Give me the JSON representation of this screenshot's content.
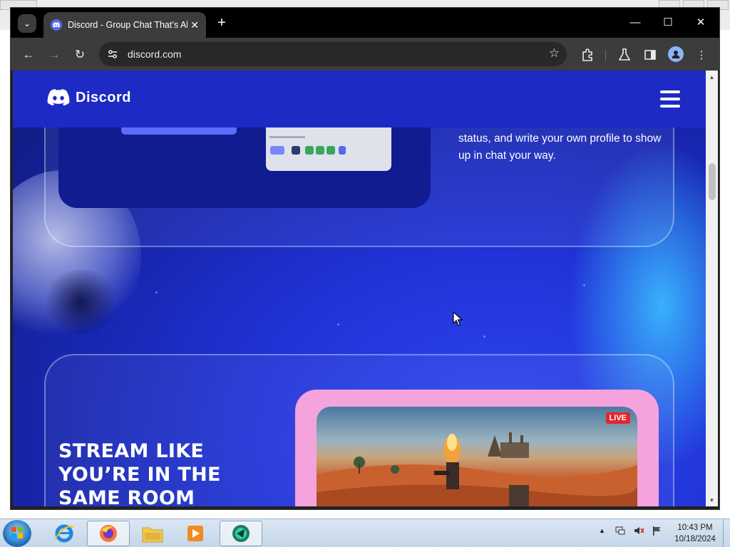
{
  "browser": {
    "tab": {
      "title": "Discord - Group Chat That’s All Fun & Games",
      "close_glyph": "✕",
      "favicon": "discord-icon"
    },
    "tab_search_glyph": "⌄",
    "new_tab_glyph": "+",
    "window_controls": {
      "minimize": "—",
      "maximize": "☐",
      "close": "✕"
    },
    "nav": {
      "back": "←",
      "forward": "→",
      "reload": "↻"
    },
    "address": {
      "url": "discord.com",
      "site_info_icon": "tune-icon"
    },
    "bookmark_glyph": "☆",
    "toolbar_icons": [
      "extensions-icon",
      "labs-icon",
      "side-panel-icon",
      "profile-icon",
      "menu-icon"
    ],
    "menu_glyph": "⋮"
  },
  "page": {
    "navbar": {
      "brand": "Discord",
      "brand_color": "#1d2ac4"
    },
    "profile_section": {
      "text": "status, and write your own profile to show up in chat your way."
    },
    "stream_section": {
      "title": "STREAM LIKE\nYOU’RE IN THE\nSAME ROOM",
      "live_badge": "LIVE",
      "frame_color": "#f4a3dc"
    }
  },
  "taskbar": {
    "apps": [
      "internet-explorer-icon",
      "firefox-icon",
      "file-explorer-icon",
      "media-player-icon",
      "browser-app-icon"
    ],
    "clock": {
      "time": "10:43 PM",
      "date": "10/18/2024"
    },
    "tray_glyph": "▲"
  }
}
